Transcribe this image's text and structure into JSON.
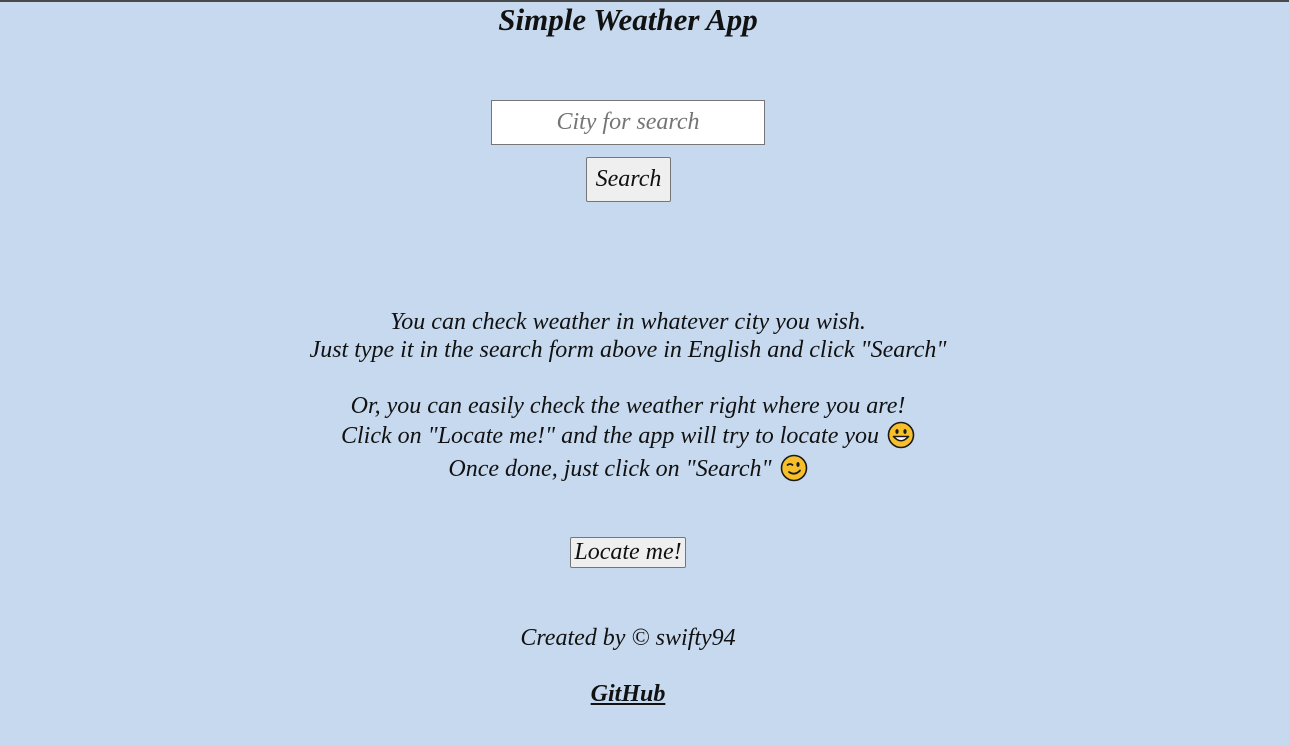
{
  "app": {
    "title": "Simple Weather App"
  },
  "search": {
    "placeholder": "City for search",
    "value": "",
    "button_label": "Search"
  },
  "info": {
    "line1": "You can check weather in whatever city you wish.",
    "line2": "Just type it in the search form above in English and click \"Search\"",
    "line3": "Or, you can easily check the weather right where you are!",
    "line4": "Click on \"Locate me!\" and the app will try to locate you",
    "line4_icon": "grinning-face-emoji",
    "line5": "Once done, just click on \"Search\"",
    "line5_icon": "winking-face-emoji"
  },
  "locate": {
    "button_label": "Locate me!"
  },
  "footer": {
    "credit": "Created by © swifty94",
    "link_label": "GitHub"
  },
  "colors": {
    "background": "#c6d9ef",
    "emoji_face": "#f7c02a"
  }
}
